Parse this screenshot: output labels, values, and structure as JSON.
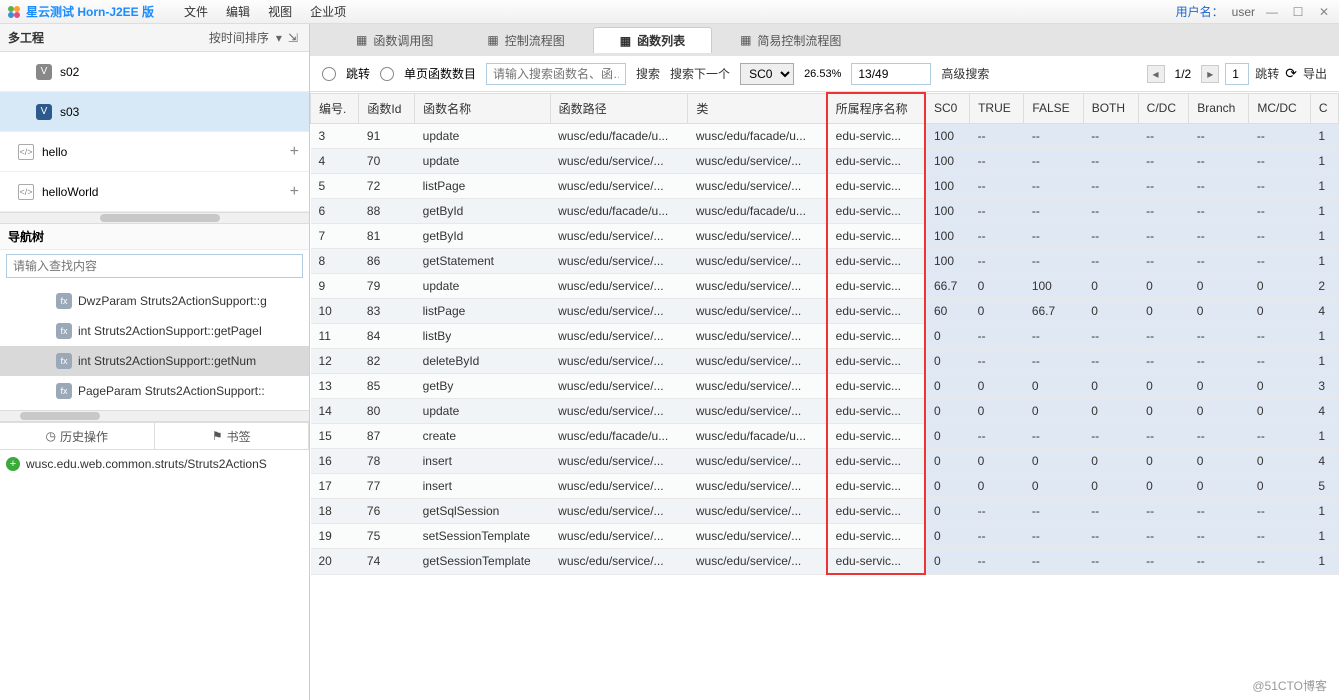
{
  "title": "星云测试 Horn-J2EE 版",
  "menu": [
    "文件",
    "编辑",
    "视图",
    "企业项"
  ],
  "user_label": "用户名：",
  "username": "user",
  "sidebar": {
    "title": "多工程",
    "sort": "按时间排序",
    "projects": [
      {
        "label": "s02",
        "sel": false
      },
      {
        "label": "s03",
        "sel": true
      }
    ],
    "others": [
      {
        "label": "hello"
      },
      {
        "label": "helloWorld"
      }
    ],
    "nav_title": "导航树",
    "nav_search_ph": "请输入查找内容",
    "nodes": [
      {
        "label": "DwzParam Struts2ActionSupport::g",
        "sel": false
      },
      {
        "label": "int Struts2ActionSupport::getPageI",
        "sel": false
      },
      {
        "label": "int Struts2ActionSupport::getNum",
        "sel": true
      },
      {
        "label": "PageParam Struts2ActionSupport::",
        "sel": false
      }
    ],
    "tabs": [
      "历史操作",
      "书签"
    ],
    "bookmark": "wusc.edu.web.common.struts/Struts2ActionS"
  },
  "top_tabs": [
    {
      "label": "函数调用图"
    },
    {
      "label": "控制流程图"
    },
    {
      "label": "函数列表",
      "active": true
    },
    {
      "label": "简易控制流程图"
    }
  ],
  "toolbar": {
    "jump": "跳转",
    "per_page": "单页函数数目",
    "search_ph": "请输入搜索函数名、函…",
    "search": "搜索",
    "search_next": "搜索下一个",
    "sc_sel": "SC0",
    "pct": "26.53%",
    "frac": "13/49",
    "adv": "高级搜索",
    "page": "1/2",
    "go_page": "1",
    "go": "跳转",
    "export": "导出"
  },
  "cols": [
    "编号.",
    "函数Id",
    "函数名称",
    "函数路径",
    "类",
    "所属程序名称",
    "SC0",
    "TRUE",
    "FALSE",
    "BOTH",
    "C/DC",
    "Branch",
    "MC/DC",
    "C"
  ],
  "rows": [
    {
      "n": "3",
      "id": "91",
      "name": "update",
      "path": "wusc/edu/facade/u...",
      "cls": "wusc/edu/facade/u...",
      "own": "edu-servic...",
      "sc": "100",
      "t": "--",
      "f": "--",
      "b": "--",
      "cd": "--",
      "br": "--",
      "mc": "--",
      "c": "1"
    },
    {
      "n": "4",
      "id": "70",
      "name": "update",
      "path": "wusc/edu/service/...",
      "cls": "wusc/edu/service/...",
      "own": "edu-servic...",
      "sc": "100",
      "t": "--",
      "f": "--",
      "b": "--",
      "cd": "--",
      "br": "--",
      "mc": "--",
      "c": "1"
    },
    {
      "n": "5",
      "id": "72",
      "name": "listPage",
      "path": "wusc/edu/service/...",
      "cls": "wusc/edu/service/...",
      "own": "edu-servic...",
      "sc": "100",
      "t": "--",
      "f": "--",
      "b": "--",
      "cd": "--",
      "br": "--",
      "mc": "--",
      "c": "1"
    },
    {
      "n": "6",
      "id": "88",
      "name": "getById",
      "path": "wusc/edu/facade/u...",
      "cls": "wusc/edu/facade/u...",
      "own": "edu-servic...",
      "sc": "100",
      "t": "--",
      "f": "--",
      "b": "--",
      "cd": "--",
      "br": "--",
      "mc": "--",
      "c": "1"
    },
    {
      "n": "7",
      "id": "81",
      "name": "getById",
      "path": "wusc/edu/service/...",
      "cls": "wusc/edu/service/...",
      "own": "edu-servic...",
      "sc": "100",
      "t": "--",
      "f": "--",
      "b": "--",
      "cd": "--",
      "br": "--",
      "mc": "--",
      "c": "1"
    },
    {
      "n": "8",
      "id": "86",
      "name": "getStatement",
      "path": "wusc/edu/service/...",
      "cls": "wusc/edu/service/...",
      "own": "edu-servic...",
      "sc": "100",
      "t": "--",
      "f": "--",
      "b": "--",
      "cd": "--",
      "br": "--",
      "mc": "--",
      "c": "1"
    },
    {
      "n": "9",
      "id": "79",
      "name": "update",
      "path": "wusc/edu/service/...",
      "cls": "wusc/edu/service/...",
      "own": "edu-servic...",
      "sc": "66.7",
      "t": "0",
      "f": "100",
      "b": "0",
      "cd": "0",
      "br": "0",
      "mc": "0",
      "c": "2"
    },
    {
      "n": "10",
      "id": "83",
      "name": "listPage",
      "path": "wusc/edu/service/...",
      "cls": "wusc/edu/service/...",
      "own": "edu-servic...",
      "sc": "60",
      "t": "0",
      "f": "66.7",
      "b": "0",
      "cd": "0",
      "br": "0",
      "mc": "0",
      "c": "4"
    },
    {
      "n": "11",
      "id": "84",
      "name": "listBy",
      "path": "wusc/edu/service/...",
      "cls": "wusc/edu/service/...",
      "own": "edu-servic...",
      "sc": "0",
      "t": "--",
      "f": "--",
      "b": "--",
      "cd": "--",
      "br": "--",
      "mc": "--",
      "c": "1"
    },
    {
      "n": "12",
      "id": "82",
      "name": "deleteById",
      "path": "wusc/edu/service/...",
      "cls": "wusc/edu/service/...",
      "own": "edu-servic...",
      "sc": "0",
      "t": "--",
      "f": "--",
      "b": "--",
      "cd": "--",
      "br": "--",
      "mc": "--",
      "c": "1"
    },
    {
      "n": "13",
      "id": "85",
      "name": "getBy",
      "path": "wusc/edu/service/...",
      "cls": "wusc/edu/service/...",
      "own": "edu-servic...",
      "sc": "0",
      "t": "0",
      "f": "0",
      "b": "0",
      "cd": "0",
      "br": "0",
      "mc": "0",
      "c": "3"
    },
    {
      "n": "14",
      "id": "80",
      "name": "update",
      "path": "wusc/edu/service/...",
      "cls": "wusc/edu/service/...",
      "own": "edu-servic...",
      "sc": "0",
      "t": "0",
      "f": "0",
      "b": "0",
      "cd": "0",
      "br": "0",
      "mc": "0",
      "c": "4"
    },
    {
      "n": "15",
      "id": "87",
      "name": "create",
      "path": "wusc/edu/facade/u...",
      "cls": "wusc/edu/facade/u...",
      "own": "edu-servic...",
      "sc": "0",
      "t": "--",
      "f": "--",
      "b": "--",
      "cd": "--",
      "br": "--",
      "mc": "--",
      "c": "1"
    },
    {
      "n": "16",
      "id": "78",
      "name": "insert",
      "path": "wusc/edu/service/...",
      "cls": "wusc/edu/service/...",
      "own": "edu-servic...",
      "sc": "0",
      "t": "0",
      "f": "0",
      "b": "0",
      "cd": "0",
      "br": "0",
      "mc": "0",
      "c": "4"
    },
    {
      "n": "17",
      "id": "77",
      "name": "insert",
      "path": "wusc/edu/service/...",
      "cls": "wusc/edu/service/...",
      "own": "edu-servic...",
      "sc": "0",
      "t": "0",
      "f": "0",
      "b": "0",
      "cd": "0",
      "br": "0",
      "mc": "0",
      "c": "5"
    },
    {
      "n": "18",
      "id": "76",
      "name": "getSqlSession",
      "path": "wusc/edu/service/...",
      "cls": "wusc/edu/service/...",
      "own": "edu-servic...",
      "sc": "0",
      "t": "--",
      "f": "--",
      "b": "--",
      "cd": "--",
      "br": "--",
      "mc": "--",
      "c": "1"
    },
    {
      "n": "19",
      "id": "75",
      "name": "setSessionTemplate",
      "path": "wusc/edu/service/...",
      "cls": "wusc/edu/service/...",
      "own": "edu-servic...",
      "sc": "0",
      "t": "--",
      "f": "--",
      "b": "--",
      "cd": "--",
      "br": "--",
      "mc": "--",
      "c": "1"
    },
    {
      "n": "20",
      "id": "74",
      "name": "getSessionTemplate",
      "path": "wusc/edu/service/...",
      "cls": "wusc/edu/service/...",
      "own": "edu-servic...",
      "sc": "0",
      "t": "--",
      "f": "--",
      "b": "--",
      "cd": "--",
      "br": "--",
      "mc": "--",
      "c": "1"
    }
  ],
  "watermark": "@51CTO博客"
}
